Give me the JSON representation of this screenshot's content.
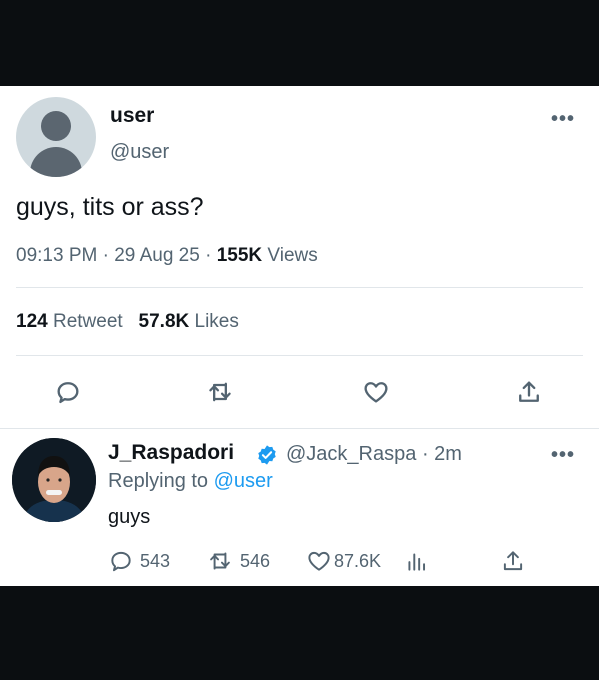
{
  "tweet": {
    "display_name": "user",
    "handle": "@user",
    "more_label": "•••",
    "text": "guys, tits or ass?",
    "time": "09:13 PM",
    "sep1": "·",
    "date": "29 Aug 25",
    "sep2": "·",
    "views_count": "155K",
    "views_label": "Views",
    "retweets_count": "124",
    "retweets_label": "Retweet",
    "likes_count": "57.8K",
    "likes_label": "Likes"
  },
  "reply": {
    "display_name": "J_Raspadori",
    "handle": "@Jack_Raspa",
    "sep": "·",
    "age": "2m",
    "more_label": "•••",
    "replying_prefix": "Replying to",
    "replying_to": "@user",
    "text": "guys",
    "reply_count": "543",
    "retweet_count": "546",
    "like_count": "87.6K"
  },
  "colors": {
    "accent": "#1d9bf0",
    "secondary_text": "#536471",
    "background_outer": "#0b0e11"
  },
  "icons": [
    "reply-icon",
    "retweet-icon",
    "like-icon",
    "share-icon",
    "views-icon",
    "verified-icon",
    "more-icon"
  ]
}
